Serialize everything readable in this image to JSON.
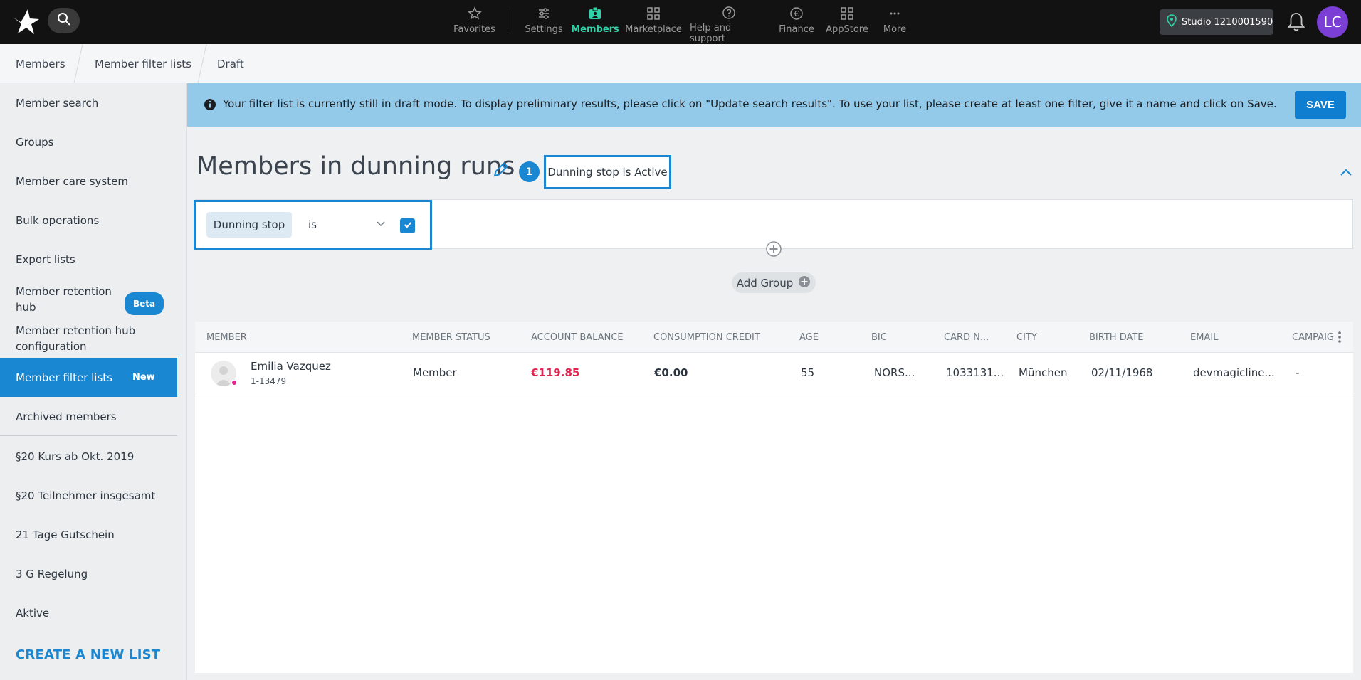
{
  "nav": {
    "items": [
      {
        "label": "Favorites",
        "icon": "star-icon"
      },
      {
        "label": "Settings",
        "icon": "sliders-icon"
      },
      {
        "label": "Members",
        "icon": "member-badge-icon"
      },
      {
        "label": "Marketplace",
        "icon": "grid-icon"
      },
      {
        "label": "Help and support",
        "icon": "question-icon"
      },
      {
        "label": "Finance",
        "icon": "euro-icon"
      },
      {
        "label": "AppStore",
        "icon": "apps-icon"
      },
      {
        "label": "More",
        "icon": "ellipsis-icon"
      }
    ],
    "active": "Members",
    "studio": "Studio 1210001590",
    "user_initials": "LC"
  },
  "breadcrumb": [
    "Members",
    "Member filter lists",
    "Draft"
  ],
  "sidebar": {
    "items": [
      "Member search",
      "Groups",
      "Member care system",
      "Bulk operations",
      "Export lists",
      "Member retention hub",
      "Member retention hub configuration",
      "Member filter lists",
      "Archived members",
      "§20 Kurs ab Okt. 2019",
      "§20 Teilnehmer insgesamt",
      "21 Tage Gutschein",
      "3 G Regelung",
      "Aktive"
    ],
    "beta_badge": "Beta",
    "new_badge": "New",
    "create_link": "CREATE A NEW LIST"
  },
  "banner": {
    "text": "Your filter list is currently still in draft mode. To display preliminary results, please click on \"Update search results\". To use your list, please create at least one filter, give it a name and click on Save.",
    "save_label": "SAVE"
  },
  "list": {
    "title": "Members in dunning runs",
    "filter_count": "1",
    "filter_summary": "Dunning stop is Active"
  },
  "filter": {
    "field": "Dunning stop",
    "operator": "is",
    "add_group_label": "Add Group"
  },
  "table": {
    "columns": [
      "MEMBER",
      "MEMBER STATUS",
      "ACCOUNT BALANCE",
      "CONSUMPTION CREDIT",
      "AGE",
      "BIC",
      "CARD N...",
      "CITY",
      "BIRTH DATE",
      "EMAIL",
      "CAMPAIG"
    ],
    "rows": [
      {
        "name": "Emilia Vazquez",
        "id": "1-13479",
        "status": "Member",
        "balance": "€119.85",
        "credit": "€0.00",
        "age": "55",
        "bic": "NORS...",
        "card": "1033131...",
        "city": "München",
        "birth_date": "02/11/1968",
        "email": "devmagicline...",
        "campaign": "-"
      }
    ]
  },
  "colors": {
    "accent": "#1a87d3",
    "nav_active": "#2ed3a7",
    "banner_bg": "#93c9e9",
    "negative_balance": "#e0244f"
  }
}
